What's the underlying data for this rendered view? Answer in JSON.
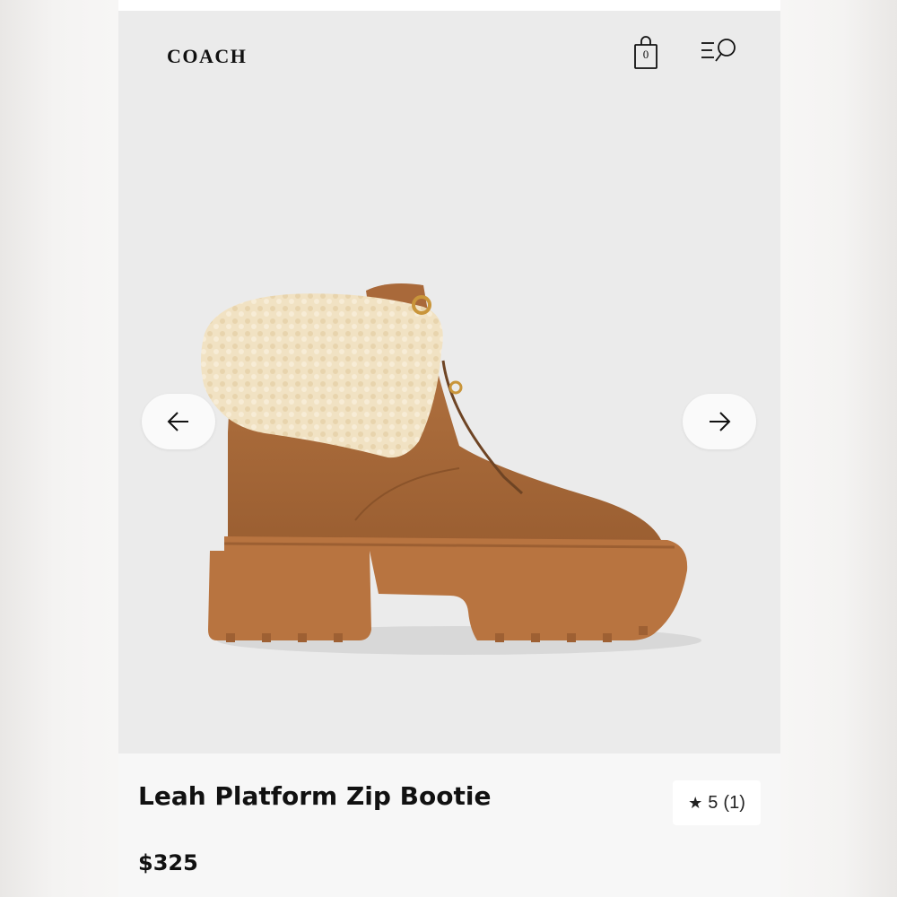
{
  "brand": {
    "logo_text": "COACH"
  },
  "header": {
    "bag_count": "0",
    "bag_icon": "shopping-bag-icon",
    "menu_icon": "menu-search-icon"
  },
  "gallery": {
    "prev_icon": "arrow-left-icon",
    "next_icon": "arrow-right-icon"
  },
  "product": {
    "title": "Leah Platform Zip Bootie",
    "price": "$325",
    "rating": {
      "star_icon": "★",
      "score": "5",
      "count": "(1)"
    }
  },
  "colors": {
    "suede": "#a8693a",
    "sole": "#b87440",
    "shearling": "#f1e2c3",
    "hardware": "#c9953a"
  }
}
